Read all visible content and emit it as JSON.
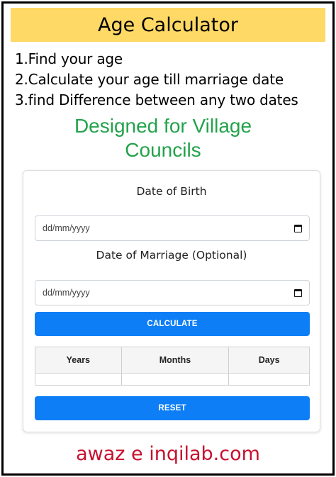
{
  "header": {
    "title": "Age Calculator"
  },
  "features": [
    "1.Find your age",
    "2.Calculate your age till marriage date",
    "3.find Difference between any two dates"
  ],
  "tagline": {
    "line1": "Designed for Village",
    "line2": "Councils"
  },
  "form": {
    "dob_label": "Date of Birth",
    "dob_placeholder": "dd/mm/yyyy",
    "dom_label": "Date of Marriage (Optional)",
    "dom_placeholder": "dd/mm/yyyy",
    "calculate_label": "CALCULATE",
    "reset_label": "RESET"
  },
  "results": {
    "columns": [
      "Years",
      "Months",
      "Days"
    ],
    "values": [
      "",
      "",
      ""
    ]
  },
  "footer": {
    "text": "awaz e inqilab.com"
  },
  "colors": {
    "header_bg": "#ffd966",
    "tagline": "#22a34a",
    "button": "#0d7ef5",
    "footer": "#c8102e"
  },
  "icons": {
    "date_picker": "calendar-icon"
  }
}
